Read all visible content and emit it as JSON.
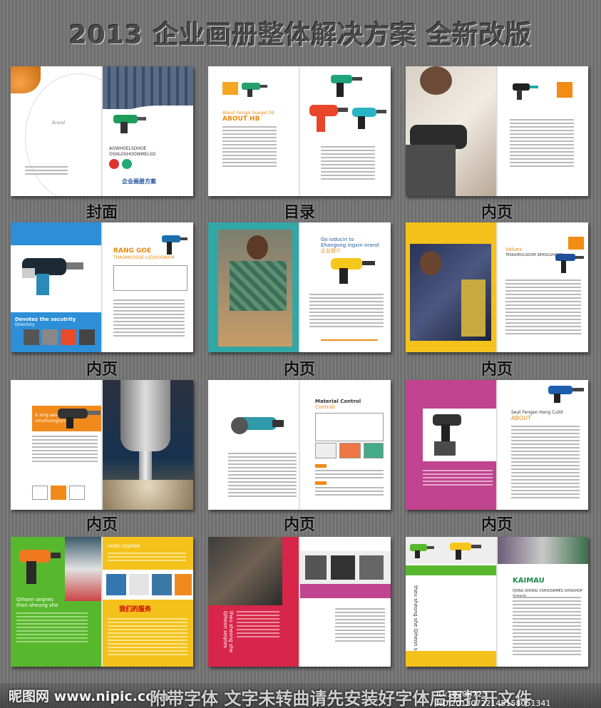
{
  "header": {
    "title": "2013 企业画册整体解决方案  全新改版"
  },
  "captions": [
    "封面",
    "目录",
    "内页",
    "内页",
    "内页",
    "内页",
    "内页",
    "内页",
    "内页"
  ],
  "spreads": {
    "cover_brand": "Brand",
    "cover_line1": "AOWHOELSDHOE",
    "cover_line2": "OSHLOSHOOWMELSD",
    "cover_logo": "企业画册方案",
    "toc_title": "ABOUT HB",
    "toc_sub": "About Fengpi Guegel ltd",
    "rang": "RANG GOE",
    "rang_sub": "THAOMEOSOE LSDHOOWEM",
    "devotes": "Devotes the secutrity",
    "devotes_sub": "Directory",
    "go": "Go ioducin to",
    "go_sub": "Ehangong ingxin orand",
    "go_cn": "企业简介",
    "values": "Values",
    "values_sub": "TENGHEOLSDOM SEHOLGHOWE",
    "xiang": "X xing seng",
    "xiang_sub": "umuhuongsyu",
    "material": "Material Control",
    "material_sub": "Contrall",
    "about_pink": "Seut Fengen Hang Culid",
    "about_pink2": "ABOUT",
    "hong": "HONG SOJOWN",
    "qihoen": "Qihoen seqnes",
    "qihoen_sub": "thon sheung she",
    "wo": "我们的服务",
    "kaimau": "KAIMAU",
    "kaimau_sub": "QONG SHONG VSHOOWMES SHOGHOP SOHUJS",
    "vert_text": "theu sheong she Qiheon seqnes"
  },
  "footer": {
    "site": "昵图网 www.nipic.com",
    "notice": "附带字体 文字未转曲请先安装好字体后再打开文件",
    "id": "ID:10206723 NO:20130722145158051341"
  },
  "colors": {
    "orange": "#f08a1c",
    "blue": "#2d8fd8",
    "teal": "#33a7a6",
    "yellow": "#f5c11b",
    "pink": "#c0448f",
    "green": "#58b82d",
    "red": "#d8264a"
  }
}
